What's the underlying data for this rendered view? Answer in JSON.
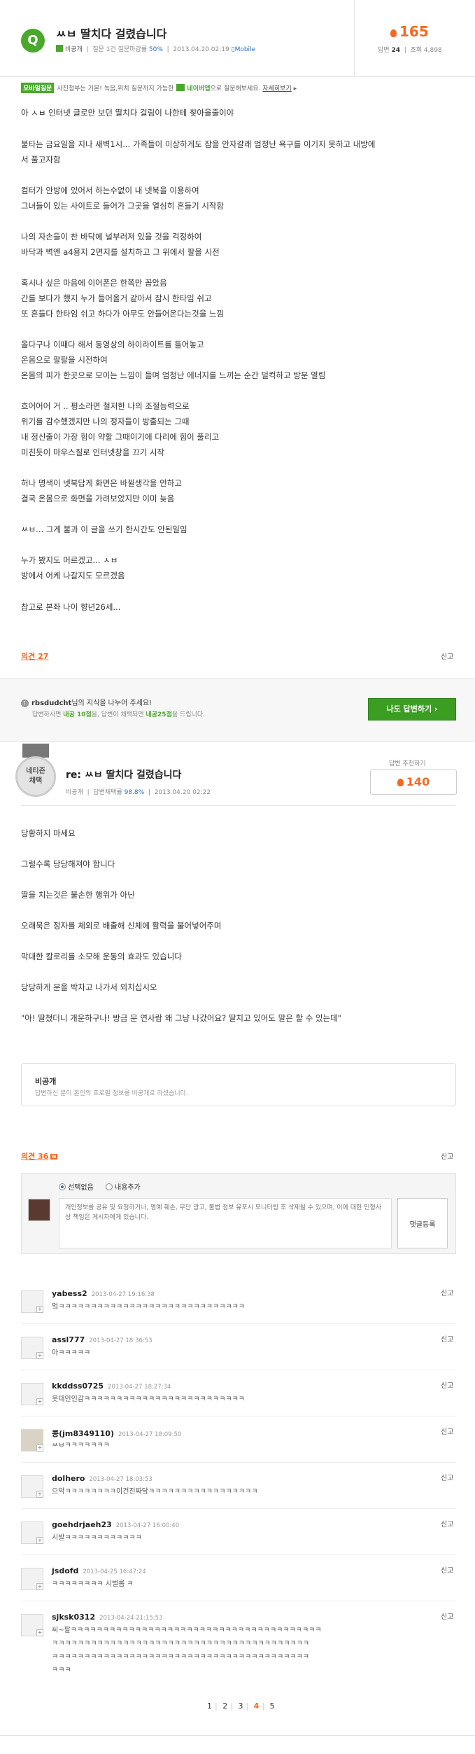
{
  "question": {
    "badge": "Q",
    "title": "ㅆㅂ 딸치다 걸렸습니다",
    "author": "비공개",
    "meta_prefix": "질문 1건  질문마감률",
    "close_rate": "50%",
    "date": "2013.04.20 02:19",
    "mobile": "Mobile",
    "score": "165",
    "answers_label": "답변",
    "answers": "24",
    "views_label": "조회",
    "views": "4,898"
  },
  "tip": {
    "tag": "모바일질문",
    "text1": "사진첨부는 기본! 녹음,위치 질문까지 가능한",
    "app": "네이버앱",
    "text2": "으로 질문해보세요.",
    "link": "자세히보기"
  },
  "question_body": [
    "아 ㅅㅂ 인터넷 글로만 보던 딸치다 걸림이 나한테 찾아올줄이야",
    "불타는 금요일을 지나 새벽1시... 가족들이 이상하게도 잠을 안자갈래 엄청난 욕구를 이기지 못하고 내방에",
    "서 풀고자함",
    "컴터가 안방에 있어서 하는수없이 내 넷북을 이용하여",
    "그녀들이 있는 사이트로 들어가 그곳을 열심히 흔들기 시작함",
    "나의 자손들이 찬 바닥에 널부러져 있을 것을 걱정하여",
    "바닥과 벽엔 a4용지 2면지를 설치하고 그 위에서 팔을 시전",
    "혹시나 싶은 마음에 이어폰은 한쪽만 꼽았음",
    "간를 보다가 했지 누가 들어올거 같아서 잠시 한타임 쉬고",
    "또 흔들다 한타임 쉬고 하다가 아무도 안들어온다는것을 느낌",
    "올다구나 이때다 해서 동영상의 하이라이트를 틀어놓고",
    "온몸으로 팔팔을 시전하여",
    "온몸의 피가 한곳으로 모이는 느낌이 들며 엄청난 에너지를 느끼는 순간 덜컥하고 방문 열림",
    "흐어어어 거 .. 평소라면 철저한 나의 조절능력으로",
    "위기를 감수했겠지만 나의 정자들이 방출되는 그때",
    "내 정신줄이 가장 힘이 약할 그때이기에 다리에 힘이 풀리고",
    "미친듯이 마우스질로 인터넷창을 끄기 시작",
    "허나 명색이 넷북답게 화면은 바뀔생각을 안하고",
    "결국 온몸으로 화면을 가려보았지만 이미 늦음",
    "ㅆㅂ... 그게 불과 이 글을 쓰기 한시간도 안된일임",
    "누가 봤지도 머르겠고... ㅅㅂ",
    "방에서 어케 나갈지도 모르겠음",
    "참고로 본좌 나이 향년26세..."
  ],
  "question_footer": {
    "opinion": "의견 27",
    "report": "신고"
  },
  "share": {
    "line1_user": "rbsdudcht",
    "line1_rest": "님의 지식을 나누어 주세요!",
    "line2_a": "답변하시면",
    "line2_b": "내공 10점",
    "line2_c": "을, 답변이 채택되면",
    "line2_d": "내공25점",
    "line2_e": "을 드립니다.",
    "button": "나도 답변하기 ›"
  },
  "answer": {
    "medal_line1": "네티즌",
    "medal_line2": "채택",
    "title": "re: ㅆㅂ 딸치다 걸렸습니다",
    "author": "비공개",
    "meta_label": "답변채택률",
    "rate": "98.8%",
    "date": "2013.04.20 02:22",
    "score_label": "답변 추천하기",
    "score": "140",
    "body": [
      "당황하지 마세요",
      "그럴수록 당당해져야 합니다",
      "딸을 치는것은 불손한 행위가 아닌",
      "오래묵은 정자를 체외로 배출해 신체에 활력을 불어넣어주며",
      "막대한 칼로리를 소모해 운동의 효과도 있습니다",
      "당당하게 문을 박차고 나가서 외치십시오",
      "\"아! 딸쳤더니 개운하구나! 방금 문 연사람 왜 그냥 나갔어요? 딸치고 있어도 말은 할 수 있는데\""
    ],
    "private_title": "비공개",
    "private_desc": "답변하신 분이 본인의 프로필 정보를 비공개로 하셨습니다.",
    "opinion": "의견 36",
    "new_badge": "N",
    "report": "신고"
  },
  "comment_form": {
    "option1": "선택없음",
    "option2": "내용추가",
    "placeholder": "개인정보를 공유 및 요청하거나, 명예 훼손, 무단 광고, 불법 정보 유포시 모니터링 후 삭제될 수 있으며, 이에 대한 민형사상 책임은 게시자에게 있습니다.",
    "submit": "댓글등록"
  },
  "comments": [
    {
      "name": "yabess2",
      "date": "2013-04-27 19:16:38",
      "text": [
        "엌ㅋㅋㅋㅋㅋㅋㅋㅋㅋㅋㅋㅋㅋㅋㅋㅋㅋㅋㅋㅋㅋㅋㅋㅋㅋㅋㅋㅋㅋ"
      ],
      "report": "신고"
    },
    {
      "name": "assl777",
      "date": "2013-04-27 18:36:53",
      "text": [
        "아ㅋㅋㅋㅋㅋ"
      ],
      "report": "신고"
    },
    {
      "name": "kkddss0725",
      "date": "2013-04-27 18:27:34",
      "text": [
        "웃대인인감ㅋㅋㅋㅋㅋㅋㅋㅋㅋㅋㅋㅋㅋㅋㅋㅋㅋㅋㅋㅋㅋㅋㅋㅋㅋ"
      ],
      "report": "신고"
    },
    {
      "name": "콩(jm8349110)",
      "date": "2013-04-27 18:09:50",
      "text": [
        "ㅆㅂㅋㅋㅋㅋㅋㅋㅋ"
      ],
      "report": "신고"
    },
    {
      "name": "dolhero",
      "date": "2013-04-27 18:03:53",
      "text": [
        "으악ㅋㅋㅋㅋㅋㅋㅋㅋ이건진짜닼ㅋㅋㅋㅋㅋㅋㅋㅋㅋㅋㅋㅋㅋㅋㅋㅋㅋ"
      ],
      "report": "신고"
    },
    {
      "name": "goehdrjaeh23",
      "date": "2013-04-27 16:00:40",
      "text": [
        "시발ㅋㅋㅋㅋㅋㅋㅋㅋㅋㅋㅋㅋ"
      ],
      "report": "신고"
    },
    {
      "name": "jsdofd",
      "date": "2013-04-25 16:47:24",
      "text": [
        "ㅋㅋㅋㅋㅋㅋㅋㅋ 시벌롬 ㅋ"
      ],
      "report": "신고"
    },
    {
      "name": "sjksk0312",
      "date": "2013-04-24 21:15:53",
      "text": [
        "씨~팔ㅋㅋㅋㅋㅋㅋㅋㅋㅋㅋㅋㅋㅋㅋㅋㅋㅋㅋㅋㅋㅋㅋㅋㅋㅋㅋㅋㅋㅋㅋㅋㅋㅋㅋㅋㅋㅋㅋㅋ",
        "ㅋㅋㅋㅋㅋㅋㅋㅋㅋㅋㅋㅋㅋㅋㅋㅋㅋㅋㅋㅋㅋㅋㅋㅋㅋㅋㅋㅋㅋㅋㅋㅋㅋㅋㅋㅋㅋㅋㅋㅋ",
        "ㅋㅋㅋㅋㅋㅋㅋㅋㅋㅋㅋㅋㅋㅋㅋㅋㅋㅋㅋㅋㅋㅋㅋㅋㅋㅋㅋㅋㅋㅋㅋㅋㅋㅋㅋㅋㅋㅋㅋㅋ",
        "ㅋㅋㅋ"
      ],
      "report": "신고"
    }
  ],
  "pagination": {
    "pages": [
      "1",
      "2",
      "3",
      "4",
      "5"
    ],
    "current": "4"
  },
  "colors": {
    "accent_orange": "#f26a21",
    "green": "#4aa82c",
    "link_blue": "#2e6db3"
  }
}
